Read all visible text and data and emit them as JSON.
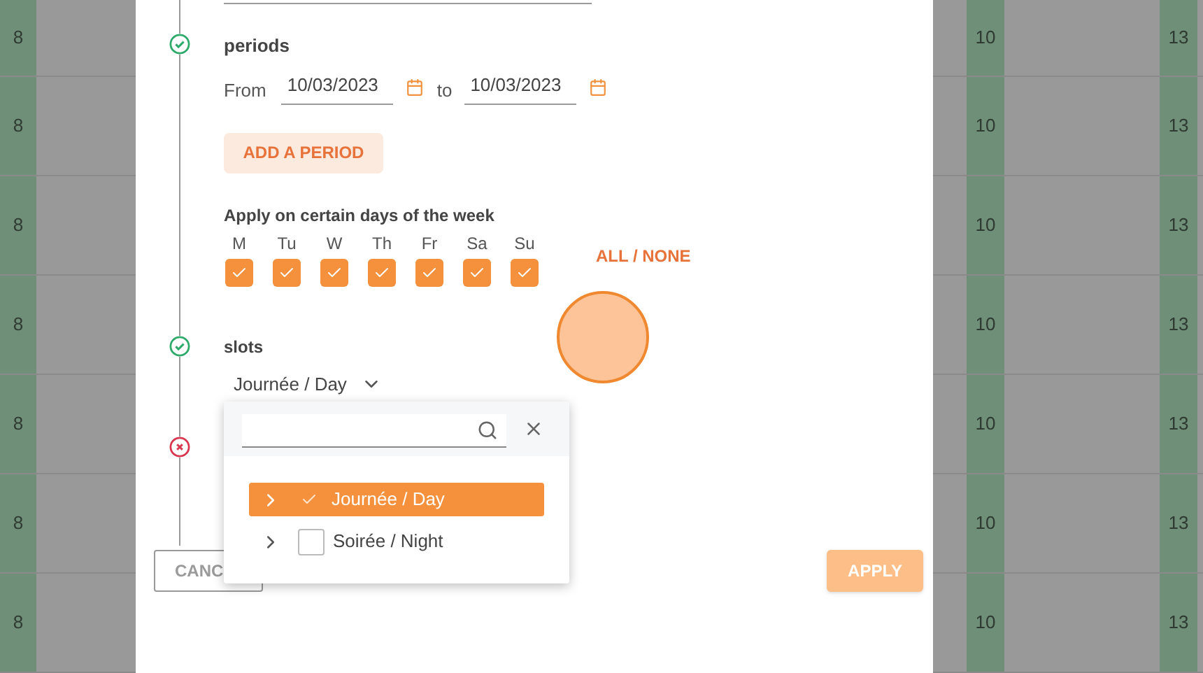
{
  "background_rows": [
    {
      "cells": [
        "8",
        "10",
        "13"
      ]
    },
    {
      "cells": [
        "8",
        "10",
        "13"
      ]
    },
    {
      "cells": [
        "8",
        "10",
        "13"
      ]
    },
    {
      "cells": [
        "8",
        "10",
        "13"
      ]
    },
    {
      "cells": [
        "8",
        "10",
        "13"
      ]
    },
    {
      "cells": [
        "8",
        "10",
        "13"
      ]
    },
    {
      "cells": [
        "8",
        "10",
        "13"
      ]
    }
  ],
  "periods": {
    "valid": true,
    "label": "periods",
    "from_label": "From",
    "from": "10/03/2023",
    "to_label": "to",
    "to": "10/03/2023",
    "add_button": "ADD A PERIOD"
  },
  "weekdays": {
    "heading": "Apply on certain days of the week",
    "toggle_all": "ALL / NONE",
    "days": [
      {
        "label": "M",
        "checked": true
      },
      {
        "label": "Tu",
        "checked": true
      },
      {
        "label": "W",
        "checked": true
      },
      {
        "label": "Th",
        "checked": true
      },
      {
        "label": "Fr",
        "checked": true
      },
      {
        "label": "Sa",
        "checked": true
      },
      {
        "label": "Su",
        "checked": true
      }
    ]
  },
  "slots": {
    "valid": true,
    "label": "slots",
    "value": "Journée / Day"
  },
  "next_step": {
    "valid": false
  },
  "dropdown": {
    "items": [
      {
        "label": "Journée / Day",
        "selected": true,
        "checked": true
      },
      {
        "label": "Soirée / Night",
        "selected": false,
        "checked": false
      }
    ]
  },
  "buttons": {
    "cancel": "CANC",
    "apply": "APPLY",
    "apply_disabled": true
  }
}
